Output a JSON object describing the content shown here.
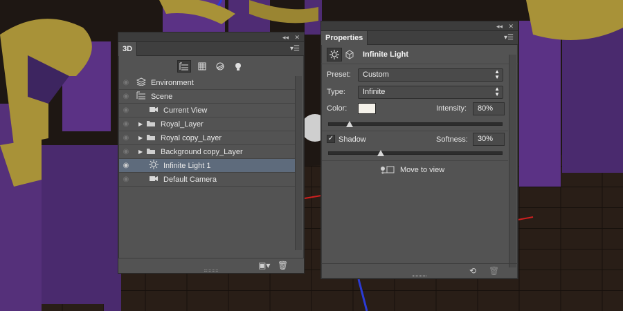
{
  "panel3d": {
    "tab": "3D",
    "toolbar": [
      "whole-scene-icon",
      "meshes-icon",
      "materials-icon",
      "lights-icon"
    ],
    "items": [
      {
        "label": "Environment",
        "icon": "environment-icon",
        "expandable": false,
        "visible": false,
        "selected": false
      },
      {
        "label": "Scene",
        "icon": "scene-icon",
        "expandable": false,
        "visible": false,
        "selected": false
      },
      {
        "label": "Current View",
        "icon": "camera-icon",
        "expandable": false,
        "visible": false,
        "selected": false
      },
      {
        "label": "Royal_Layer",
        "icon": "folder-icon",
        "expandable": true,
        "visible": false,
        "selected": false
      },
      {
        "label": "Royal copy_Layer",
        "icon": "folder-icon",
        "expandable": true,
        "visible": false,
        "selected": false
      },
      {
        "label": "Background copy_Layer",
        "icon": "folder-icon",
        "expandable": true,
        "visible": false,
        "selected": false
      },
      {
        "label": "Infinite Light 1",
        "icon": "light-icon",
        "expandable": false,
        "visible": true,
        "selected": true
      },
      {
        "label": "Default Camera",
        "icon": "camera-icon",
        "expandable": false,
        "visible": false,
        "selected": false
      }
    ]
  },
  "properties": {
    "tab": "Properties",
    "title": "Infinite Light",
    "preset_label": "Preset:",
    "preset_value": "Custom",
    "type_label": "Type:",
    "type_value": "Infinite",
    "color_label": "Color:",
    "color_value": "#f5f2ea",
    "intensity_label": "Intensity:",
    "intensity_value": "80%",
    "intensity_fraction": 0.12,
    "shadow_label": "Shadow",
    "shadow_checked": true,
    "softness_label": "Softness:",
    "softness_value": "30%",
    "softness_fraction": 0.3,
    "move_to_view": "Move to view"
  }
}
